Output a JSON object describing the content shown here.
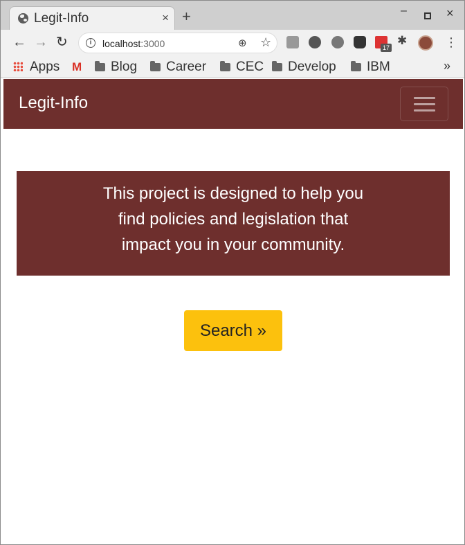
{
  "browser": {
    "tab_title": "Legit-Info",
    "tab_close": "×",
    "new_tab": "+",
    "window_minimize": "–",
    "window_close": "×",
    "url_host": "localhost",
    "url_port": ":3000",
    "extension_badge": "17",
    "bookmarks_more": "»",
    "bookmarks": [
      {
        "label": "Apps",
        "icon": "apps-grid-icon"
      },
      {
        "label": "",
        "icon": "gmail-icon"
      },
      {
        "label": "Blog",
        "icon": "folder-icon"
      },
      {
        "label": "Career",
        "icon": "folder-icon"
      },
      {
        "label": "CEC",
        "icon": "folder-icon"
      },
      {
        "label": "Develop",
        "icon": "folder-icon"
      },
      {
        "label": "IBM",
        "icon": "folder-icon"
      }
    ]
  },
  "page": {
    "brand": "Legit-Info",
    "jumbotron_lines": [
      "This project is designed to help you",
      "find policies and legislation that",
      "impact you in your community."
    ],
    "search_label": "Search »"
  },
  "colors": {
    "primary": "#6e2f2d",
    "button": "#fcc10d"
  }
}
